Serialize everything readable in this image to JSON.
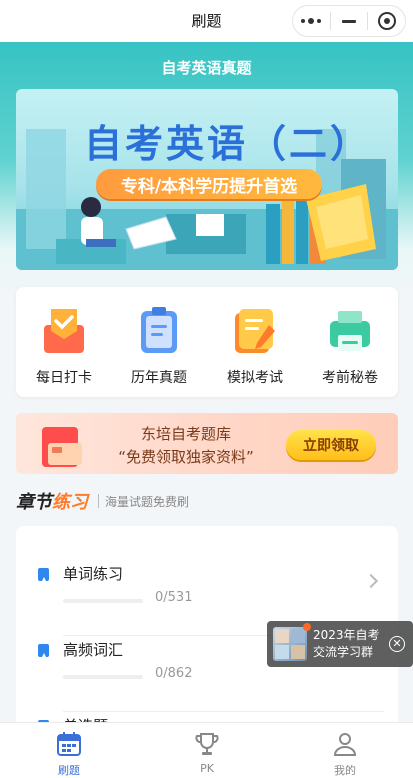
{
  "nav": {
    "title": "刷题"
  },
  "page_title": "自考英语真题",
  "banner": {
    "title": "自考英语（二）",
    "tagline": "专科/本科学历提升首选"
  },
  "quick_actions": [
    {
      "label": "每日打卡",
      "icon": "calendar-check-icon",
      "color": "#ff7e55"
    },
    {
      "label": "历年真题",
      "icon": "clipboard-icon",
      "color": "#5b9bf5"
    },
    {
      "label": "模拟考试",
      "icon": "notebook-pencil-icon",
      "color": "#ffb23a"
    },
    {
      "label": "考前秘卷",
      "icon": "printer-icon",
      "color": "#3ccaa0"
    }
  ],
  "promo": {
    "line1": "东培自考题库",
    "line2": "“免费领取独家资料”",
    "button": "立即领取"
  },
  "section": {
    "title_a": "章节",
    "title_b": "练习",
    "subtitle": "海量试题免费刷"
  },
  "chapters": [
    {
      "title": "单词练习",
      "progress": "0/531"
    },
    {
      "title": "高频词汇",
      "progress": "0/862"
    },
    {
      "title": "单选题",
      "progress": ""
    }
  ],
  "floating": {
    "text": "2023年自考交流学习群"
  },
  "tabs": [
    {
      "label": "刷题",
      "icon": "calendar-icon",
      "active": true
    },
    {
      "label": "PK",
      "icon": "trophy-icon",
      "active": false
    },
    {
      "label": "我的",
      "icon": "user-icon",
      "active": false
    }
  ],
  "colors": {
    "accent": "#37c3c3",
    "active_tab": "#3a6fd8",
    "inactive_tab": "#888888",
    "book_icon": "#2e88f0"
  }
}
